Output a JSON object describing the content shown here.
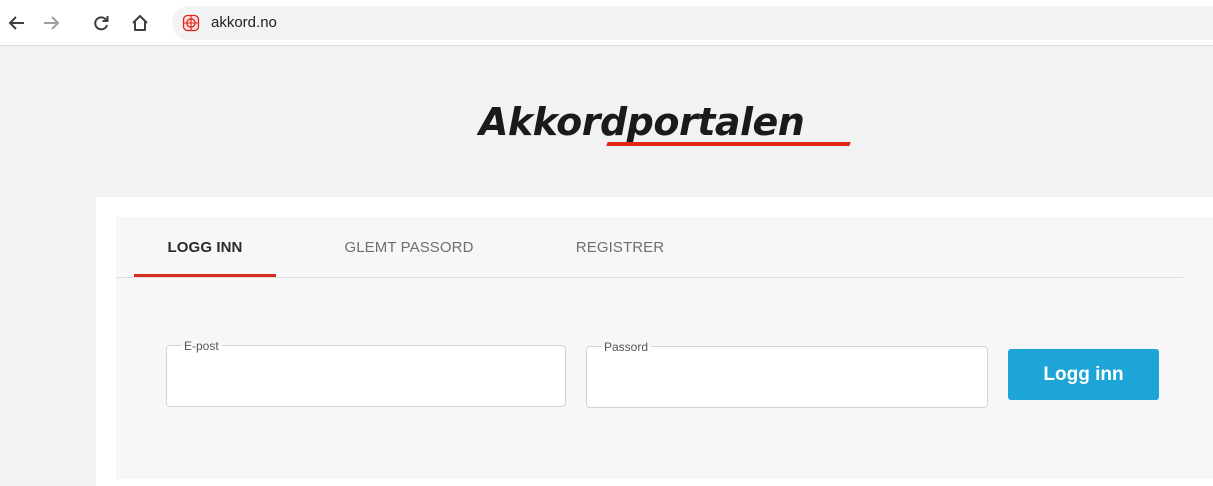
{
  "browser": {
    "url": "akkord.no",
    "back_icon": "arrow-left-icon",
    "forward_icon": "arrow-right-icon",
    "reload_icon": "reload-icon",
    "home_icon": "home-icon",
    "site_icon": "site-favicon-icon"
  },
  "logo": {
    "text": "Akkordportalen",
    "accent_color": "#e2241a"
  },
  "tabs": [
    {
      "label": "LOGG INN",
      "active": true
    },
    {
      "label": "GLEMT PASSORD",
      "active": false
    },
    {
      "label": "REGISTRER",
      "active": false
    }
  ],
  "form": {
    "email": {
      "label": "E-post",
      "value": ""
    },
    "password": {
      "label": "Passord",
      "value": ""
    },
    "submit_label": "Logg inn",
    "submit_color": "#1ea5d8"
  }
}
